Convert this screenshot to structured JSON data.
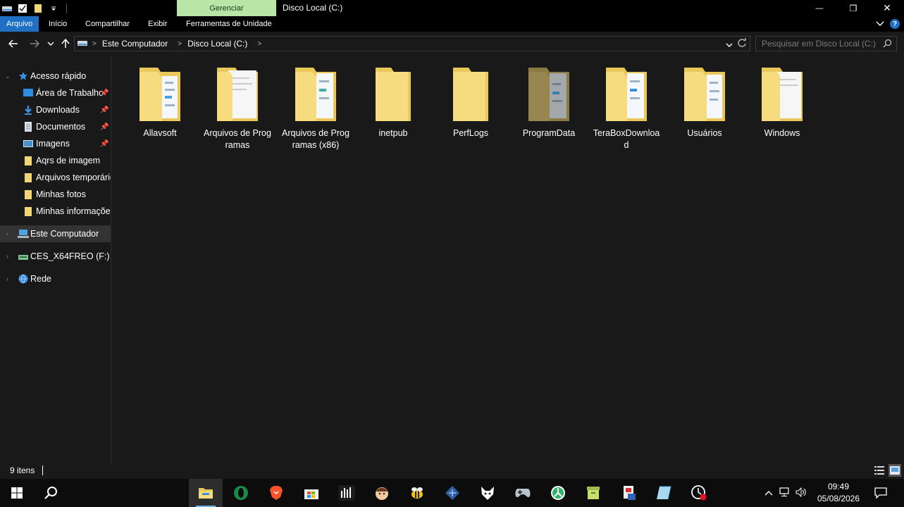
{
  "window": {
    "title": "Disco Local (C:)",
    "context_tab": "Gerenciar",
    "controls": {
      "minimize": "—",
      "maximize": "❐",
      "close": "✕"
    }
  },
  "ribbon": {
    "tabs": [
      {
        "label": "Arquivo",
        "active": true
      },
      {
        "label": "Início"
      },
      {
        "label": "Compartilhar"
      },
      {
        "label": "Exibir"
      },
      {
        "label": "Ferramentas de Unidade"
      }
    ],
    "help": "?"
  },
  "address": {
    "crumbs": [
      "Este Computador",
      "Disco Local (C:)"
    ],
    "search_placeholder": "Pesquisar em Disco Local (C:)"
  },
  "nav": {
    "quick_access": "Acesso rápido",
    "quick_items": [
      {
        "label": "Área de Trabalho",
        "icon": "desktop-icon",
        "pinned": true
      },
      {
        "label": "Downloads",
        "icon": "downloads-icon",
        "pinned": true
      },
      {
        "label": "Documentos",
        "icon": "documents-icon",
        "pinned": true
      },
      {
        "label": "Imagens",
        "icon": "pictures-icon",
        "pinned": true
      },
      {
        "label": "Aqrs de imagem",
        "icon": "folder-icon"
      },
      {
        "label": "Arquivos temporários",
        "icon": "folder-icon"
      },
      {
        "label": "Minhas fotos",
        "icon": "folder-icon"
      },
      {
        "label": "Minhas informações",
        "icon": "folder-icon"
      }
    ],
    "this_pc": "Este Computador",
    "drive": "CES_X64FREO (F:)",
    "network": "Rede"
  },
  "folders": [
    {
      "name": "Allavsoft"
    },
    {
      "name": "Arquivos de Programas"
    },
    {
      "name": "Arquivos de Programas (x86)"
    },
    {
      "name": "inetpub"
    },
    {
      "name": "PerfLogs"
    },
    {
      "name": "ProgramData"
    },
    {
      "name": "TeraBoxDownload"
    },
    {
      "name": "Usuários"
    },
    {
      "name": "Windows"
    }
  ],
  "status": {
    "item_count": "9 itens"
  },
  "taskbar": {
    "time": "09:49",
    "date": "05/08/2026",
    "apps": [
      "start-icon",
      "search-icon",
      "file-explorer-icon",
      "opera-icon",
      "brave-icon",
      "ms-store-icon",
      "audio-app-icon",
      "face-app-icon",
      "bee-app-icon",
      "network-app-icon",
      "fox-app-icon",
      "gamepad-icon",
      "green-circle-app-icon",
      "archive-app-icon",
      "document-app-icon",
      "notes-app-icon",
      "recorder-app-icon"
    ]
  },
  "colors": {
    "accent": "#1f6fc4",
    "manage_tab": "#b7e6a7",
    "folder": "#f2d674",
    "background": "#191919"
  }
}
